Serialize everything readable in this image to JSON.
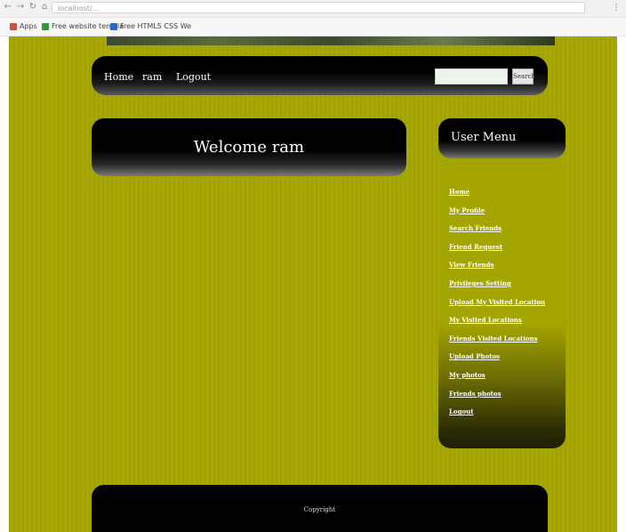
{
  "browser": {
    "url_text": "localhost/...",
    "bookmarks": [
      "Apps",
      "Free website templa",
      "Free HTML5 CSS We"
    ],
    "colors": {
      "apps": "#d44a3a",
      "bm1": "#2e9a3b",
      "bm2": "#2f66c5"
    }
  },
  "nav": {
    "links": [
      "Home",
      "ram",
      "Logout"
    ],
    "search_button": "Search",
    "search_value": ""
  },
  "welcome": {
    "title": "Welcome ram"
  },
  "user_menu": {
    "title": "User Menu",
    "items": [
      "Home",
      "My Profile",
      "Search Friends",
      "Friend Request",
      "View Friends",
      "Privileges Setting",
      "Upload My Visited Location",
      "My Visited Locations",
      "Friends Visited Locations",
      "Upload Photos",
      "My photos",
      "Friends photos",
      "Logout"
    ]
  },
  "footer": {
    "text": "Copyright"
  },
  "colors": {
    "page_background": "#a5a500",
    "panel": "#000000",
    "text": "#ffffff"
  }
}
